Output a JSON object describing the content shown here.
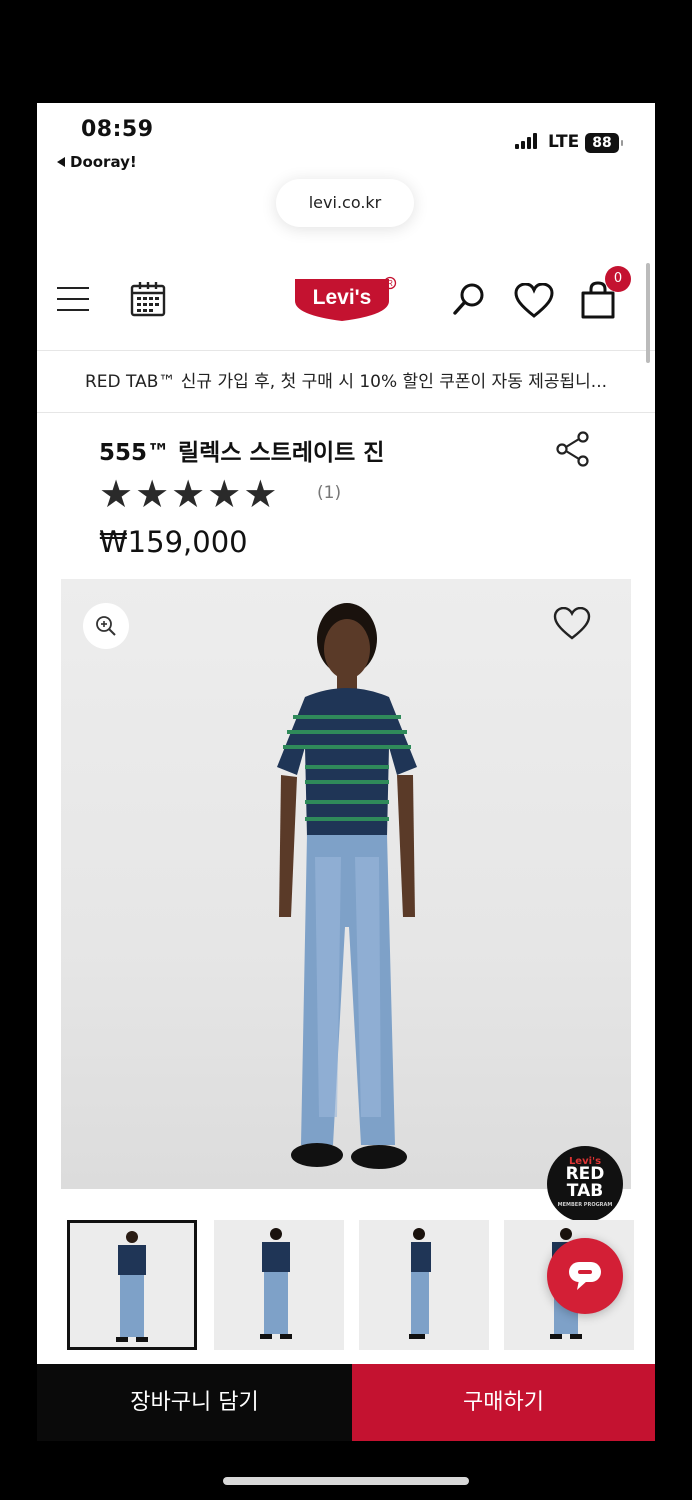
{
  "status_bar": {
    "time": "08:59",
    "back_app": "Dooray!",
    "network": "LTE",
    "battery": "88"
  },
  "browser": {
    "url": "levi.co.kr"
  },
  "header": {
    "logo_text": "Levi's",
    "cart_count": "0",
    "icons": [
      "menu-icon",
      "calendar-icon",
      "search-icon",
      "heart-icon",
      "bag-icon"
    ]
  },
  "promo": {
    "text": "RED TAB™ 신규 가입 후, 첫 구매 시 10% 할인 쿠폰이 자동 제공됩니..."
  },
  "product": {
    "title": "555™ 릴렉스 스트레이트 진",
    "rating": 5,
    "stars": [
      "★",
      "★",
      "★",
      "★",
      "★"
    ],
    "review_count": "(1)",
    "price": "₩159,000"
  },
  "gallery": {
    "badge_top": "Levi's",
    "badge_main": "RED TAB",
    "badge_sub": "MEMBER PROGRAM",
    "selected_index": 0
  },
  "actions": {
    "cart_label": "장바구니 담기",
    "buy_label": "구매하기"
  },
  "colors": {
    "brand_red": "#c41230",
    "dark": "#0a0a0a"
  }
}
